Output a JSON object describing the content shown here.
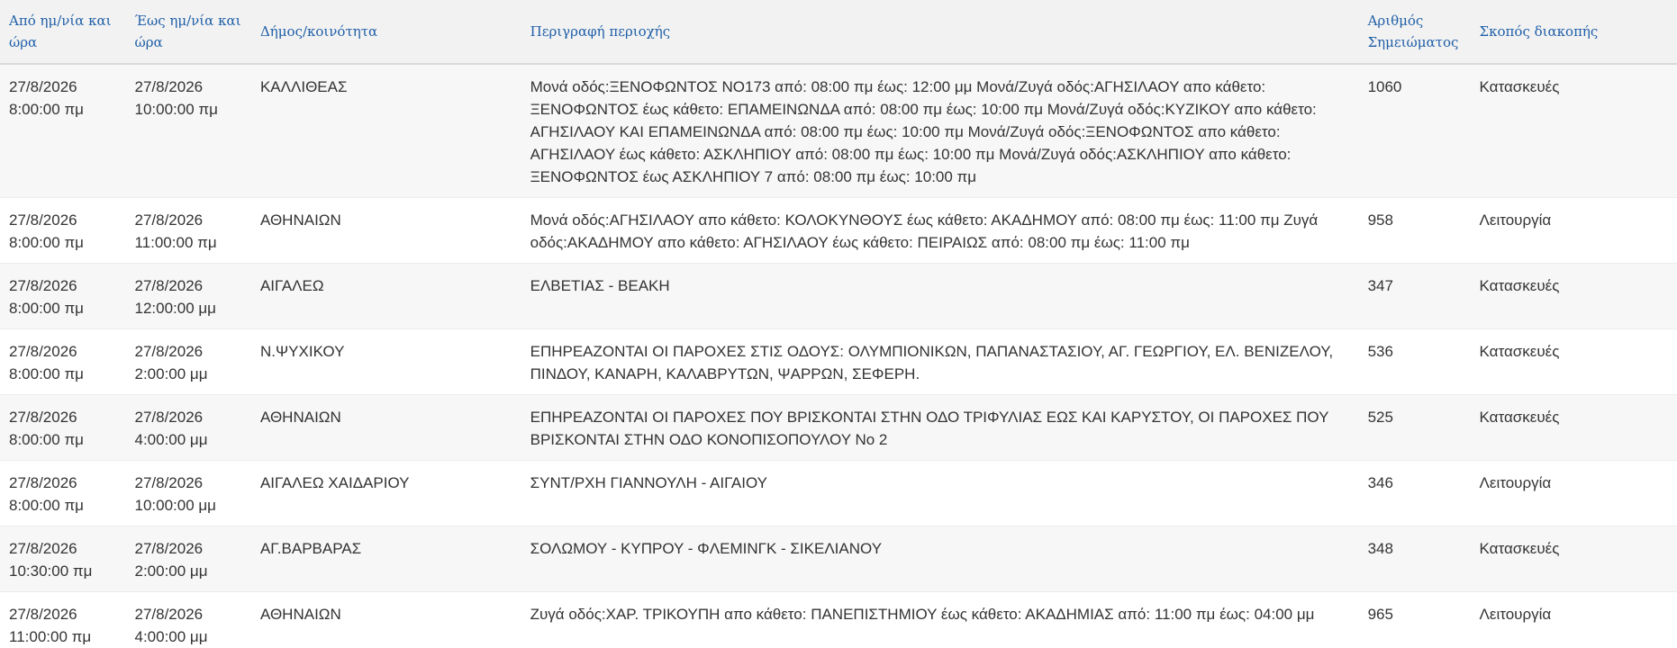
{
  "table": {
    "headers": [
      "Από ημ/νία και ώρα",
      "Έως ημ/νία και ώρα",
      "Δήμος/κοινότητα",
      "Περιγραφή περιοχής",
      "Αριθμός Σημειώματος",
      "Σκοπός διακοπής"
    ],
    "rows": [
      {
        "from": "27/8/2026 8:00:00 πμ",
        "to": "27/8/2026 10:00:00 πμ",
        "municipality": "ΚΑΛΛΙΘΕΑΣ",
        "description": "Μονά οδός:ΞΕΝΟΦΩΝΤΟΣ ΝΟ173 από: 08:00 πμ έως: 12:00 μμ Μονά/Ζυγά οδός:ΑΓΗΣΙΛΑΟΥ απο κάθετο: ΞΕΝΟΦΩΝΤΟΣ έως κάθετο: ΕΠΑΜΕΙΝΩΝΔΑ από: 08:00 πμ έως: 10:00 πμ Μονά/Ζυγά οδός:ΚΥΖΙΚΟΥ απο κάθετο: ΑΓΗΣΙΛΑΟΥ ΚΑΙ ΕΠΑΜΕΙΝΩΝΔΑ από: 08:00 πμ έως: 10:00 πμ Μονά/Ζυγά οδός:ΞΕΝΟΦΩΝΤΟΣ απο κάθετο: ΑΓΗΣΙΛΑΟΥ έως κάθετο: ΑΣΚΛΗΠΙΟΥ από: 08:00 πμ έως: 10:00 πμ Μονά/Ζυγά οδός:ΑΣΚΛΗΠΙΟΥ απο κάθετο: ΞΕΝΟΦΩΝΤΟΣ έως ΑΣΚΛΗΠΙΟΥ 7 από: 08:00 πμ έως: 10:00 πμ",
        "note": "1060",
        "purpose": "Κατασκευές"
      },
      {
        "from": "27/8/2026 8:00:00 πμ",
        "to": "27/8/2026 11:00:00 πμ",
        "municipality": "ΑΘΗΝΑΙΩΝ",
        "description": "Μονά οδός:ΑΓΗΣΙΛΑΟΥ απο κάθετο: ΚΟΛΟΚΥΝΘΟΥΣ έως κάθετο: ΑΚΑΔΗΜΟΥ από: 08:00 πμ έως: 11:00 πμ Ζυγά οδός:ΑΚΑΔΗΜΟΥ απο κάθετο: ΑΓΗΣΙΛΑΟΥ έως κάθετο: ΠΕΙΡΑΙΩΣ από: 08:00 πμ έως: 11:00 πμ",
        "note": "958",
        "purpose": "Λειτουργία"
      },
      {
        "from": "27/8/2026 8:00:00 πμ",
        "to": "27/8/2026 12:00:00 μμ",
        "municipality": "ΑΙΓΑΛΕΩ",
        "description": "ΕΛΒΕΤΙΑΣ - ΒΕΑΚΗ",
        "note": "347",
        "purpose": "Κατασκευές"
      },
      {
        "from": "27/8/2026 8:00:00 πμ",
        "to": "27/8/2026 2:00:00 μμ",
        "municipality": "Ν.ΨΥΧΙΚΟΥ",
        "description": "ΕΠΗΡΕΑΖΟΝΤΑΙ ΟΙ ΠΑΡΟΧΕΣ ΣΤΙΣ ΟΔΟΥΣ: ΟΛΥΜΠΙΟΝΙΚΩΝ, ΠΑΠΑΝΑΣΤΑΣΙΟΥ, ΑΓ. ΓΕΩΡΓΙΟΥ, ΕΛ. ΒΕΝΙΖΕΛΟΥ, ΠΙΝΔΟΥ, ΚΑΝΑΡΗ, ΚΑΛΑΒΡΥΤΩΝ, ΨΑΡΡΩΝ, ΣΕΦΕΡΗ.",
        "note": "536",
        "purpose": "Κατασκευές"
      },
      {
        "from": "27/8/2026 8:00:00 πμ",
        "to": "27/8/2026 4:00:00 μμ",
        "municipality": "ΑΘΗΝΑΙΩΝ",
        "description": "ΕΠΗΡΕΑΖΟΝΤΑΙ ΟΙ ΠΑΡΟΧΕΣ ΠΟΥ ΒΡΙΣΚΟΝΤΑΙ ΣΤΗΝ ΟΔΟ ΤΡΙΦΥΛΙΑΣ ΕΩΣ ΚΑΙ ΚΑΡΥΣΤΟΥ, ΟΙ ΠΑΡΟΧΕΣ ΠΟΥ ΒΡΙΣΚΟΝΤΑΙ ΣΤΗΝ ΟΔΟ ΚΟΝΟΠΙΣΟΠΟΥΛΟΥ Νο 2",
        "note": "525",
        "purpose": "Κατασκευές"
      },
      {
        "from": "27/8/2026 8:00:00 πμ",
        "to": "27/8/2026 10:00:00 μμ",
        "municipality": "ΑΙΓΑΛΕΩ ΧΑΙΔΑΡΙΟΥ",
        "description": "ΣΥΝΤ/ΡΧΗ ΓΙΑΝΝΟΥΛΗ - ΑΙΓΑΙΟΥ",
        "note": "346",
        "purpose": "Λειτουργία"
      },
      {
        "from": "27/8/2026 10:30:00 πμ",
        "to": "27/8/2026 2:00:00 μμ",
        "municipality": "ΑΓ.ΒΑΡΒΑΡΑΣ",
        "description": "ΣΟΛΩΜΟΥ - ΚΥΠΡΟΥ - ΦΛΕΜΙΝΓΚ - ΣΙΚΕΛΙΑΝΟΥ",
        "note": "348",
        "purpose": "Κατασκευές"
      },
      {
        "from": "27/8/2026 11:00:00 πμ",
        "to": "27/8/2026 4:00:00 μμ",
        "municipality": "ΑΘΗΝΑΙΩΝ",
        "description": "Ζυγά οδός:ΧΑΡ. ΤΡΙΚΟΥΠΗ απο κάθετο: ΠΑΝΕΠΙΣΤΗΜΙΟΥ έως κάθετο: ΑΚΑΔΗΜΙΑΣ από: 11:00 πμ έως: 04:00 μμ",
        "note": "965",
        "purpose": "Λειτουργία"
      }
    ]
  }
}
